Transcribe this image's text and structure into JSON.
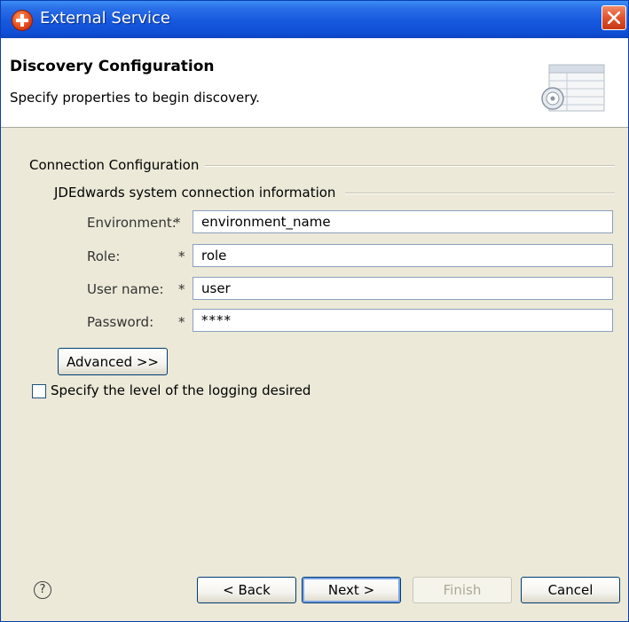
{
  "window": {
    "title": "External Service"
  },
  "banner": {
    "title": "Discovery Configuration",
    "description": "Specify properties to begin discovery."
  },
  "connection": {
    "group_label": "Connection Configuration",
    "subgroup_label": "JDEdwards system connection information",
    "required_marker": "*",
    "fields": {
      "environment": {
        "label": "Environment:",
        "value": "environment_name"
      },
      "role": {
        "label": "Role:",
        "value": "role"
      },
      "username": {
        "label": "User name:",
        "value": "user"
      },
      "password": {
        "label": "Password:",
        "value": "****"
      }
    },
    "advanced_label": "Advanced >>"
  },
  "logging": {
    "label": "Specify the level of the logging desired",
    "checked": false
  },
  "footer": {
    "help_icon": "?",
    "back_label": "< Back",
    "next_label": "Next >",
    "finish_label": "Finish",
    "cancel_label": "Cancel"
  },
  "colors": {
    "titlebar": "#1658de",
    "dialog_background": "#ece9d8",
    "close_button": "#e2532d"
  }
}
